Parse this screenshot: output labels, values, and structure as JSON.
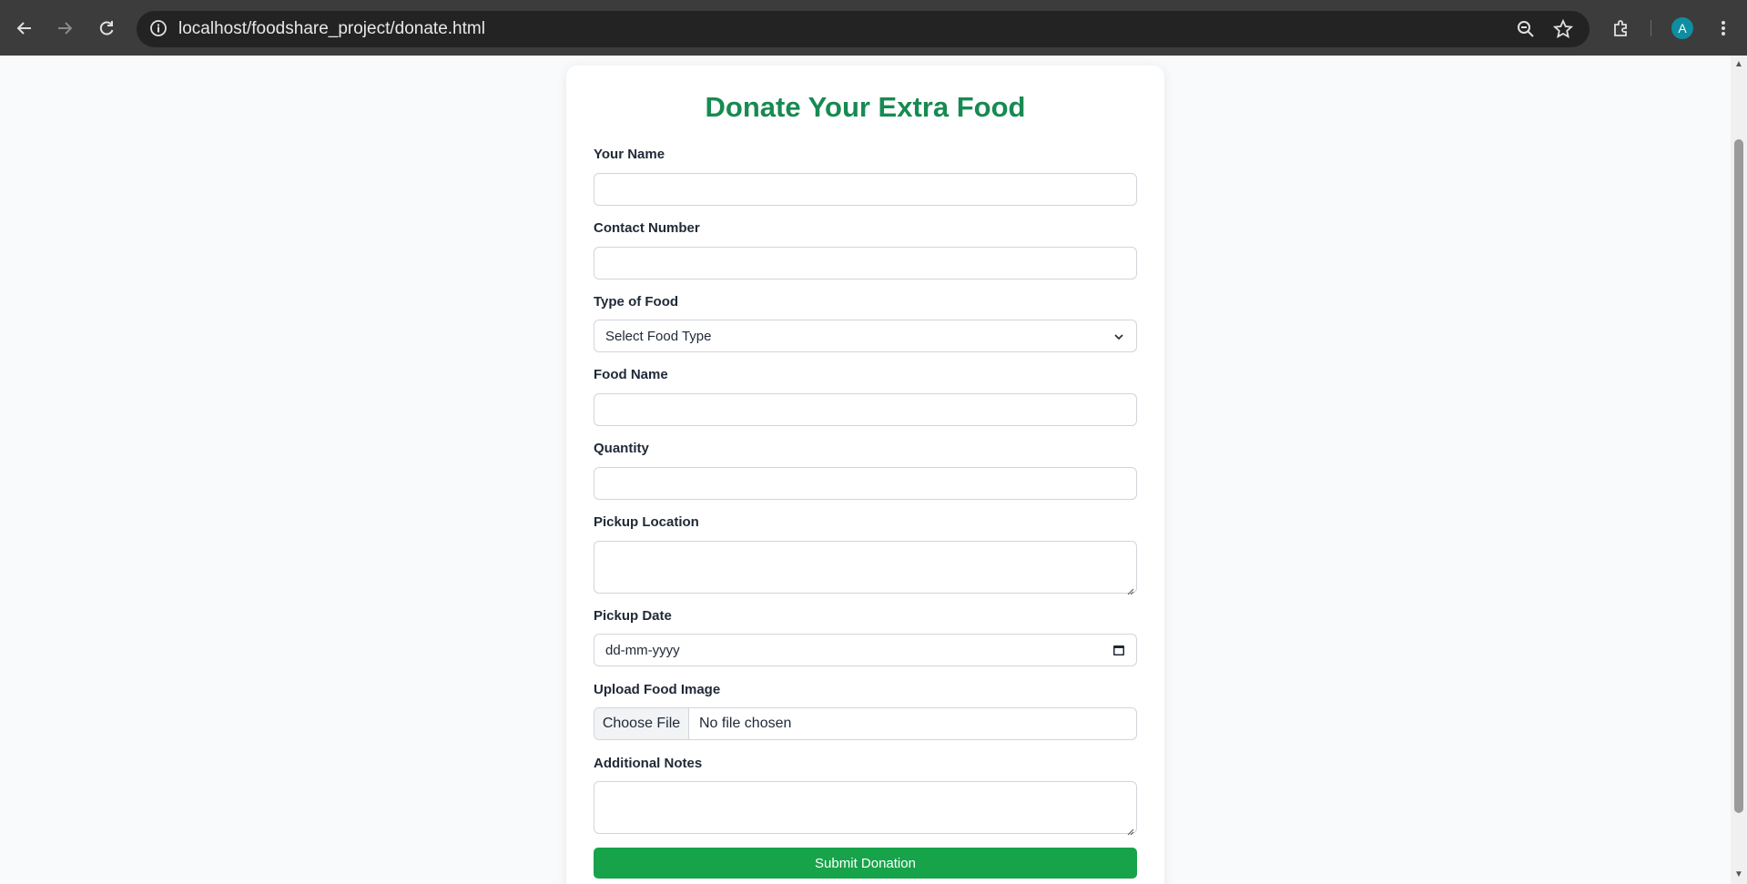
{
  "browser": {
    "url": "localhost/foodshare_project/donate.html",
    "profile_initial": "A",
    "icons": [
      "back-icon",
      "forward-icon",
      "reload-icon",
      "site-info-icon",
      "zoom-icon",
      "bookmark-star-icon",
      "extensions-icon",
      "menu-icon"
    ]
  },
  "form": {
    "title": "Donate Your Extra Food",
    "name_label": "Your Name",
    "contact_label": "Contact Number",
    "food_type_label": "Type of Food",
    "food_type_selected": "Select Food Type",
    "food_name_label": "Food Name",
    "quantity_label": "Quantity",
    "pickup_location_label": "Pickup Location",
    "pickup_date_label": "Pickup Date",
    "pickup_date_placeholder": "dd-mm-yyyy",
    "upload_label": "Upload Food Image",
    "choose_file": "Choose File",
    "no_file": "No file chosen",
    "notes_label": "Additional Notes",
    "submit": "Submit Donation"
  },
  "colors": {
    "title": "#178a52",
    "submit_bg": "#17a34a",
    "avatar": "#0e8ea0"
  }
}
